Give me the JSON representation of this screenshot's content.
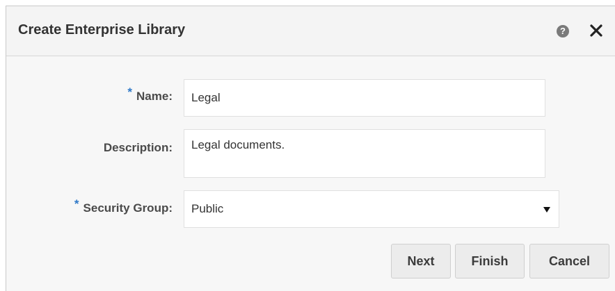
{
  "dialog": {
    "title": "Create Enterprise Library",
    "help_icon": "help-icon",
    "help_glyph": "?",
    "close_icon": "close-icon"
  },
  "form": {
    "required_marker": "*",
    "name": {
      "label": "Name:",
      "required": true,
      "value": "Legal"
    },
    "description": {
      "label": "Description:",
      "required": false,
      "value": "Legal documents."
    },
    "security_group": {
      "label": "Security Group:",
      "required": true,
      "value": "Public"
    }
  },
  "buttons": {
    "next": "Next",
    "finish": "Finish",
    "cancel": "Cancel"
  },
  "colors": {
    "required_marker": "#2f79c8",
    "dialog_background": "#f5f5f5",
    "button_background": "#ececec"
  }
}
